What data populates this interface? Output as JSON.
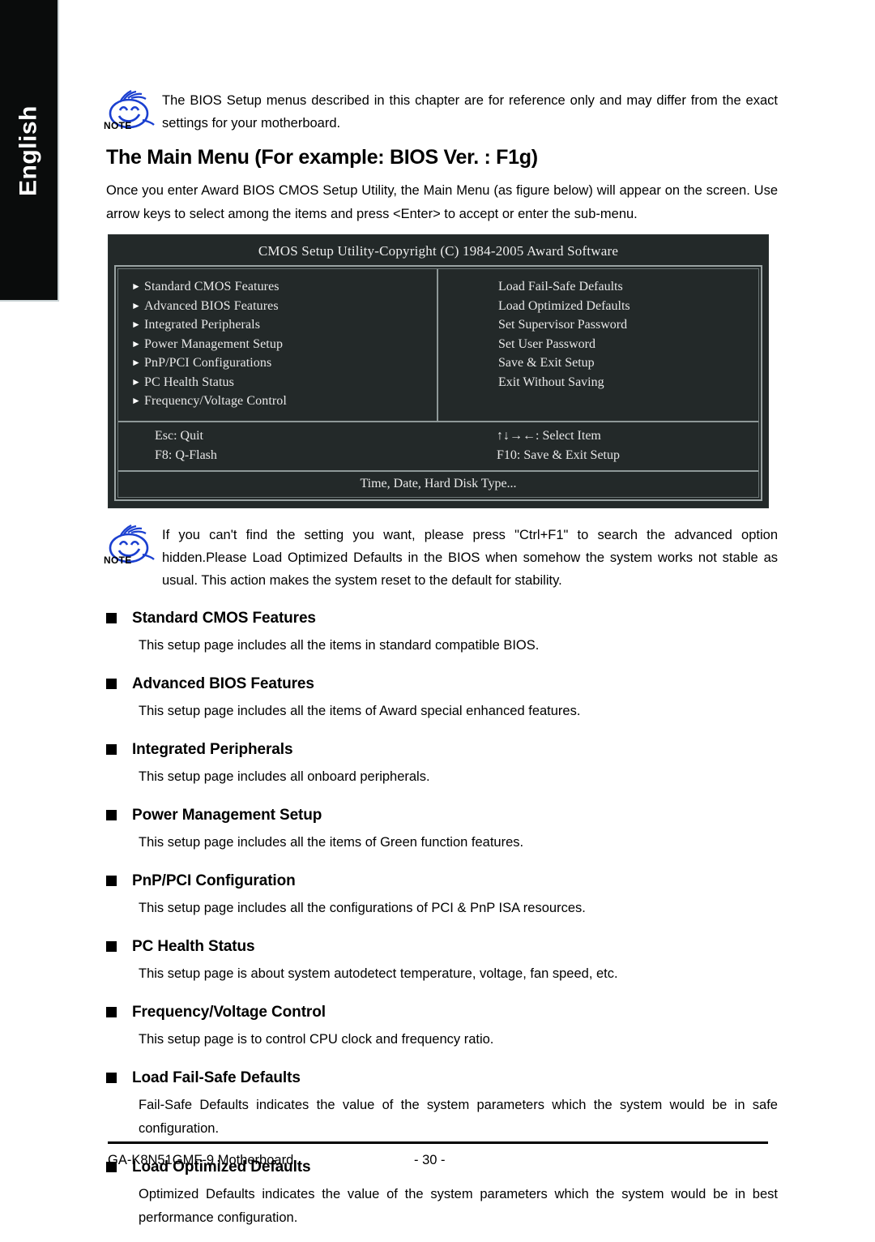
{
  "sidebar": {
    "language_label": "English"
  },
  "note_top": {
    "icon": "note-smiley-icon",
    "icon_caption": "NOTE",
    "text": "The BIOS Setup menus described in this chapter are for reference only and may differ from the exact settings for your motherboard."
  },
  "heading": "The Main Menu (For example: BIOS Ver. : F1g)",
  "intro": "Once you enter Award BIOS CMOS Setup Utility, the Main Menu (as figure below) will appear on the screen.  Use arrow keys to select among the items and press <Enter> to accept or enter the sub-menu.",
  "bios_screen": {
    "title": "CMOS Setup Utility-Copyright (C) 1984-2005 Award Software",
    "background_color": "#232929",
    "text_color": "#e8e8e8",
    "left_items": [
      "Standard CMOS Features",
      "Advanced BIOS Features",
      "Integrated Peripherals",
      "Power Management Setup",
      "PnP/PCI Configurations",
      "PC Health Status",
      "Frequency/Voltage Control"
    ],
    "left_item_marker": "right-triangle-icon",
    "right_items": [
      "Load Fail-Safe Defaults",
      "Load Optimized Defaults",
      "Set Supervisor Password",
      "Set User Password",
      "Save & Exit Setup",
      "Exit Without Saving"
    ],
    "keys": {
      "left": [
        "Esc: Quit",
        "F8: Q-Flash"
      ],
      "right": [
        "↑↓→←: Select Item",
        "F10: Save & Exit Setup"
      ]
    },
    "status_bar": "Time, Date, Hard Disk Type..."
  },
  "note_bottom": {
    "icon": "note-smiley-icon",
    "icon_caption": "NOTE",
    "text": "If you can't find the setting you want, please press \"Ctrl+F1\" to search the advanced option hidden.Please Load Optimized Defaults in the BIOS when somehow the system works not stable as usual. This action makes the system reset to the default for stability."
  },
  "sections": [
    {
      "title": "Standard CMOS Features",
      "body": "This setup page includes all the items in standard compatible BIOS."
    },
    {
      "title": "Advanced BIOS Features",
      "body": "This setup page includes all the items of Award special enhanced features."
    },
    {
      "title": "Integrated Peripherals",
      "body": "This setup page includes all onboard peripherals."
    },
    {
      "title": "Power Management Setup",
      "body": "This setup page includes all the items of Green function features."
    },
    {
      "title": "PnP/PCI Configuration",
      "body": "This setup page includes all the configurations of PCI & PnP ISA resources."
    },
    {
      "title": "PC Health Status",
      "body": "This setup page is about system autodetect temperature, voltage, fan speed, etc."
    },
    {
      "title": "Frequency/Voltage Control",
      "body": "This setup page is to control CPU clock and frequency ratio."
    },
    {
      "title": "Load Fail-Safe Defaults",
      "body": "Fail-Safe Defaults indicates the value of the system parameters which the system would be in safe configuration."
    },
    {
      "title": "Load Optimized Defaults",
      "body": "Optimized Defaults indicates the value of the system parameters which the system would be in best performance configuration."
    }
  ],
  "footer": {
    "left": "GA-K8N51GMF-9 Motherboard",
    "page_number": "- 30 -"
  }
}
